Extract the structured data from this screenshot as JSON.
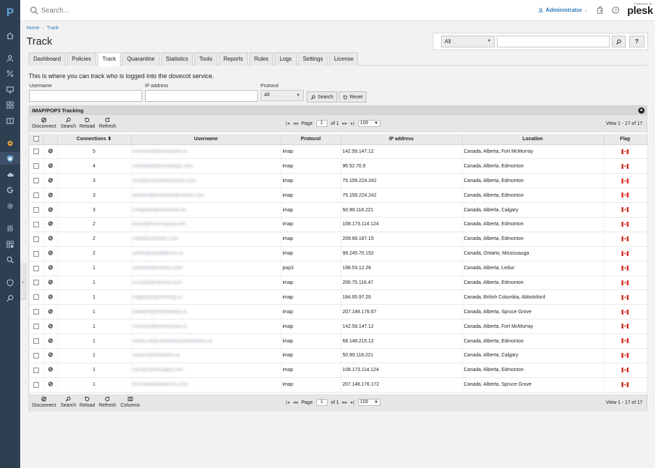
{
  "topbar": {
    "search_placeholder": "Search...",
    "user": "Administrator",
    "powered_by": "POWERED BY",
    "brand": "plesk"
  },
  "nav": {
    "logo": "P",
    "icons": [
      "home-icon",
      "user-icon",
      "percent-icon",
      "monitor-icon",
      "apps-icon",
      "book-icon",
      "puzzle-icon",
      "mail-shield-icon",
      "cloud-icon",
      "google-icon",
      "gear-icon",
      "sliders-icon",
      "grid-icon",
      "zoom-icon",
      "shield-icon",
      "search-icon"
    ]
  },
  "breadcrumb": {
    "home": "Home",
    "current": "Track"
  },
  "page_title": "Track",
  "right_search": {
    "scope": "All",
    "help": "?"
  },
  "tabs": [
    "Dashboard",
    "Policies",
    "Track",
    "Quarantine",
    "Statistics",
    "Tools",
    "Reports",
    "Rules",
    "Logs",
    "Settings",
    "License"
  ],
  "active_tab": "Track",
  "intro": "This is where you can track who is logged into the dovecot service.",
  "filter": {
    "username_label": "Username",
    "ip_label": "IP address",
    "protocol_label": "Protocol",
    "protocol_value": "All",
    "search_btn": "Search",
    "reset_btn": "Reset"
  },
  "panel": {
    "title": "IMAP/POP3 Tracking",
    "toolbar_top": [
      "Disconnect",
      "Search",
      "Reload",
      "Refresh"
    ],
    "toolbar_bottom": [
      "Disconnect",
      "Search",
      "Reload",
      "Refresh",
      "Columns"
    ],
    "pager": {
      "page_label": "Page",
      "page": "1",
      "of": "of 1",
      "per_page": "100"
    },
    "view_info": "View 1 - 17 of 17"
  },
  "columns": [
    "Connections",
    "Username",
    "Protocol",
    "IP address",
    "Location",
    "Flag"
  ],
  "rows": [
    {
      "connections": "5",
      "username": "mmoser@tindmodular.ca",
      "protocol": "imap",
      "ip": "142.59.147.12",
      "location": "Canada, Alberta, Fort McMurray"
    },
    {
      "connections": "4",
      "username": "melinda@deusedesign.com",
      "protocol": "imap",
      "ip": "96.52.70.9",
      "location": "Canada, Alberta, Edmonton"
    },
    {
      "connections": "3",
      "username": "info@ecoclearedmonton.com",
      "protocol": "imap",
      "ip": "75.159.224.242",
      "location": "Canada, Alberta, Edmonton"
    },
    {
      "connections": "3",
      "username": "desiree@ecoclearedmonton.com",
      "protocol": "imap",
      "ip": "75.159.224.242",
      "location": "Canada, Alberta, Edmonton"
    },
    {
      "connections": "3",
      "username": "info@axe@driswerke.ca",
      "protocol": "imap",
      "ip": "50.99.118.221",
      "location": "Canada, Alberta, Calgary"
    },
    {
      "connections": "2",
      "username": "tracie@mymrsupply.com",
      "protocol": "imap",
      "ip": "108.173.114.124",
      "location": "Canada, Alberta, Edmonton"
    },
    {
      "connections": "2",
      "username": "info@purehartis.com",
      "protocol": "imap",
      "ip": "209.89.187.15",
      "location": "Canada, Alberta, Edmonton"
    },
    {
      "connections": "2",
      "username": "anthel@canadafrica.ca",
      "protocol": "imap",
      "ip": "99.245.70.152",
      "location": "Canada, Ontario, Mississauga"
    },
    {
      "connections": "1",
      "username": "michelle@ovedics.com",
      "protocol": "pop3",
      "ip": "198.53.12.26",
      "location": "Canada, Alberta, Leduc"
    },
    {
      "connections": "1",
      "username": "cruza@bimterrors.com",
      "protocol": "imap",
      "ip": "206.75.116.47",
      "location": "Canada, Alberta, Edmonton"
    },
    {
      "connections": "1",
      "username": "magnus@grimoring.ca",
      "protocol": "imap",
      "ip": "184.65.97.26",
      "location": "Canada, British Columbia, Abbotsford"
    },
    {
      "connections": "1",
      "username": "bbewert@tindmodular.ca",
      "protocol": "imap",
      "ip": "207.148.176.67",
      "location": "Canada, Alberta, Spruce Grove"
    },
    {
      "connections": "1",
      "username": "mmorris@tindmodular.ca",
      "protocol": "imap",
      "ip": "142.59.147.12",
      "location": "Canada, Alberta, Fort McMurray"
    },
    {
      "connections": "1",
      "username": "wilson.nk@nicktedhomehardware.ca",
      "protocol": "imap",
      "ip": "68.148.215.12",
      "location": "Canada, Alberta, Edmonton"
    },
    {
      "connections": "1",
      "username": "sauver@driswerke.ca",
      "protocol": "imap",
      "ip": "50.99.118.221",
      "location": "Canada, Alberta, Calgary"
    },
    {
      "connections": "1",
      "username": "tsen@mymrsupply.com",
      "protocol": "imap",
      "ip": "108.173.114.124",
      "location": "Canada, Alberta, Edmonton"
    },
    {
      "connections": "1",
      "username": "ffournier@bimterrors.com",
      "protocol": "imap",
      "ip": "207.148.176.172",
      "location": "Canada, Alberta, Spruce Grove"
    }
  ],
  "colors": {
    "nav_bg": "#2f3f52",
    "link": "#2e7bb8",
    "flag_red": "#d52b1e"
  }
}
